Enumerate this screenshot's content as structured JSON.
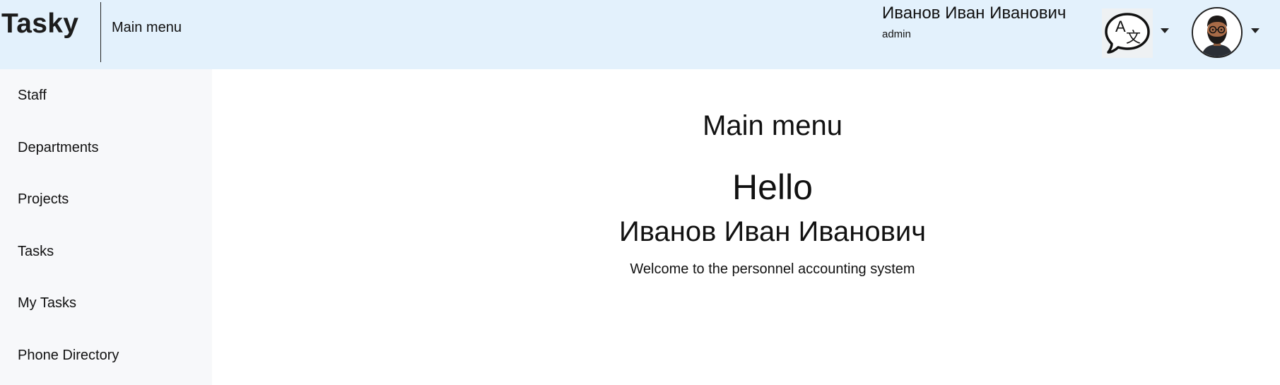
{
  "header": {
    "brand": "Tasky",
    "page_title": "Main menu",
    "user": {
      "name": "Иванов Иван Иванович",
      "role": "admin"
    },
    "language_icon": "translate-icon",
    "avatar_icon": "user-avatar",
    "background_color": "#e3f1fc"
  },
  "sidebar": {
    "background_color": "#f7f8fa",
    "items": [
      {
        "label": "Staff"
      },
      {
        "label": "Departments"
      },
      {
        "label": "Projects"
      },
      {
        "label": "Tasks"
      },
      {
        "label": "My Tasks"
      },
      {
        "label": "Phone Directory"
      }
    ]
  },
  "main": {
    "title": "Main menu",
    "hello": "Hello",
    "user_name": "Иванов Иван Иванович",
    "welcome": "Welcome to the personnel accounting system"
  }
}
